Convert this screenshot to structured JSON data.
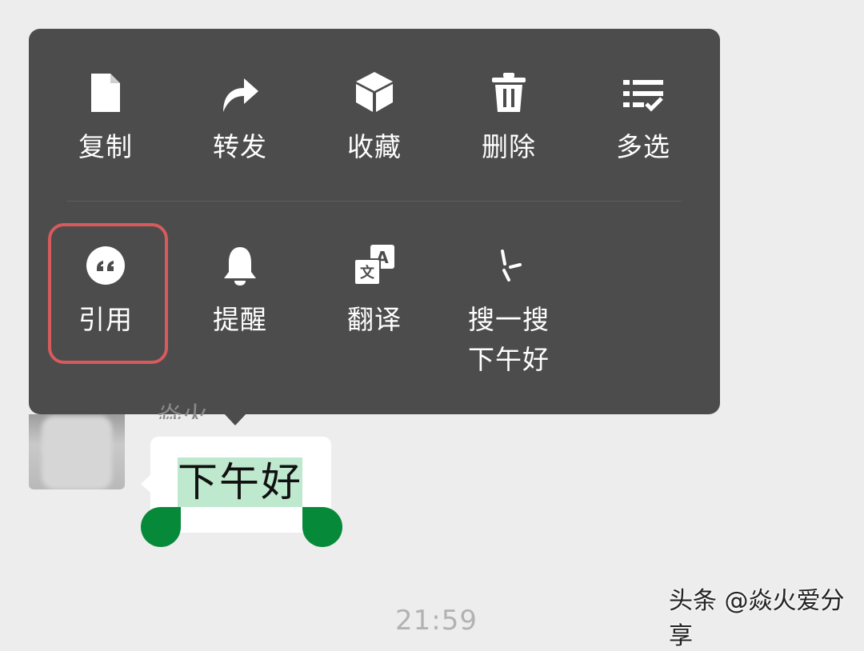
{
  "menu": {
    "row1": [
      {
        "label": "复制",
        "icon": "document-icon"
      },
      {
        "label": "转发",
        "icon": "forward-arrow-icon"
      },
      {
        "label": "收藏",
        "icon": "cube-icon"
      },
      {
        "label": "删除",
        "icon": "trash-icon"
      },
      {
        "label": "多选",
        "icon": "multi-select-list-icon"
      }
    ],
    "row2": [
      {
        "label": "引用",
        "icon": "quote-icon"
      },
      {
        "label": "提醒",
        "icon": "bell-icon"
      },
      {
        "label": "翻译",
        "icon": "translate-icon"
      },
      {
        "label": "搜一搜",
        "sub": "下午好",
        "icon": "search-spark-icon"
      }
    ],
    "highlight_color": "#d75b5d"
  },
  "chat": {
    "sender_name": "焱火",
    "message_text": "下午好",
    "time": "21:59",
    "selection_color": "#bfe9cf",
    "handle_color": "#07893a"
  },
  "watermark": "头条 @焱火爱分享"
}
